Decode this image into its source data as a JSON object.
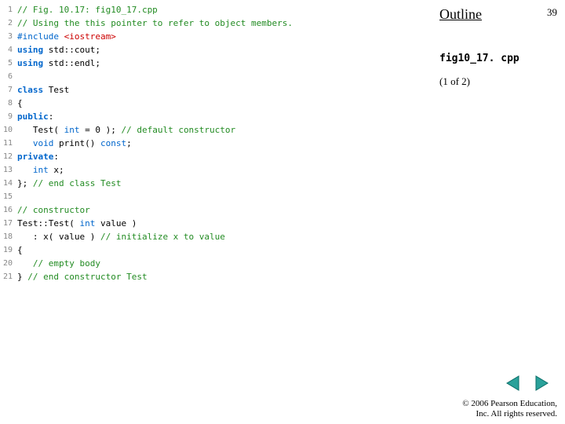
{
  "sidebar": {
    "outline": "Outline",
    "page_number": "39",
    "filename": "fig10_17. cpp",
    "part": "(1 of 2)"
  },
  "nav": {
    "prev_label": "prev",
    "next_label": "next"
  },
  "copyright": {
    "line1": "© 2006 Pearson Education,",
    "line2": "Inc.  All rights reserved."
  },
  "code": [
    {
      "n": "1",
      "tokens": [
        {
          "c": "comment",
          "t": "// Fig. 10.17: fig10_17.cpp"
        }
      ]
    },
    {
      "n": "2",
      "tokens": [
        {
          "c": "comment",
          "t": "// Using the this pointer to refer to object members."
        }
      ]
    },
    {
      "n": "3",
      "tokens": [
        {
          "c": "preproc",
          "t": "#include "
        },
        {
          "c": "angle",
          "t": "<iostream>"
        }
      ]
    },
    {
      "n": "4",
      "tokens": [
        {
          "c": "keyword-strong",
          "t": "using"
        },
        {
          "c": "plain",
          "t": " std::cout;"
        }
      ]
    },
    {
      "n": "5",
      "tokens": [
        {
          "c": "keyword-strong",
          "t": "using"
        },
        {
          "c": "plain",
          "t": " std::endl;"
        }
      ]
    },
    {
      "n": "6",
      "tokens": []
    },
    {
      "n": "7",
      "tokens": [
        {
          "c": "keyword-strong",
          "t": "class"
        },
        {
          "c": "plain",
          "t": " Test"
        }
      ]
    },
    {
      "n": "8",
      "tokens": [
        {
          "c": "plain",
          "t": "{"
        }
      ]
    },
    {
      "n": "9",
      "tokens": [
        {
          "c": "keyword-strong",
          "t": "public"
        },
        {
          "c": "plain",
          "t": ":"
        }
      ]
    },
    {
      "n": "10",
      "tokens": [
        {
          "c": "plain",
          "t": "   Test( "
        },
        {
          "c": "keyword",
          "t": "int"
        },
        {
          "c": "plain",
          "t": " = 0 ); "
        },
        {
          "c": "comment",
          "t": "// default constructor"
        }
      ]
    },
    {
      "n": "11",
      "tokens": [
        {
          "c": "plain",
          "t": "   "
        },
        {
          "c": "keyword",
          "t": "void"
        },
        {
          "c": "plain",
          "t": " print() "
        },
        {
          "c": "keyword",
          "t": "const"
        },
        {
          "c": "plain",
          "t": ";"
        }
      ]
    },
    {
      "n": "12",
      "tokens": [
        {
          "c": "keyword-strong",
          "t": "private"
        },
        {
          "c": "plain",
          "t": ":"
        }
      ]
    },
    {
      "n": "13",
      "tokens": [
        {
          "c": "plain",
          "t": "   "
        },
        {
          "c": "keyword",
          "t": "int"
        },
        {
          "c": "plain",
          "t": " x;"
        }
      ]
    },
    {
      "n": "14",
      "tokens": [
        {
          "c": "plain",
          "t": "}; "
        },
        {
          "c": "comment",
          "t": "// end class Test"
        }
      ]
    },
    {
      "n": "15",
      "tokens": []
    },
    {
      "n": "16",
      "tokens": [
        {
          "c": "comment",
          "t": "// constructor"
        }
      ]
    },
    {
      "n": "17",
      "tokens": [
        {
          "c": "plain",
          "t": "Test::Test( "
        },
        {
          "c": "keyword",
          "t": "int"
        },
        {
          "c": "plain",
          "t": " value )"
        }
      ]
    },
    {
      "n": "18",
      "tokens": [
        {
          "c": "plain",
          "t": "   : x( value ) "
        },
        {
          "c": "comment",
          "t": "// initialize x to value"
        }
      ]
    },
    {
      "n": "19",
      "tokens": [
        {
          "c": "plain",
          "t": "{"
        }
      ]
    },
    {
      "n": "20",
      "tokens": [
        {
          "c": "plain",
          "t": "   "
        },
        {
          "c": "comment",
          "t": "// empty body"
        }
      ]
    },
    {
      "n": "21",
      "tokens": [
        {
          "c": "plain",
          "t": "} "
        },
        {
          "c": "comment",
          "t": "// end constructor Test"
        }
      ]
    }
  ]
}
